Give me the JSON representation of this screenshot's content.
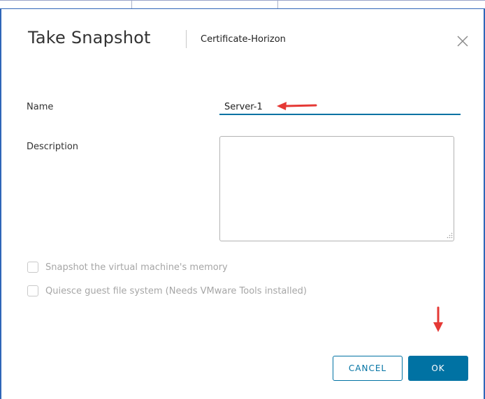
{
  "dialog": {
    "title": "Take Snapshot",
    "subtitle": "Certificate-Horizon",
    "close_icon": "close-icon"
  },
  "form": {
    "name_label": "Name",
    "name_value": "Server-1",
    "description_label": "Description",
    "description_value": "",
    "options": [
      {
        "label": "Snapshot the virtual machine's memory",
        "checked": false,
        "enabled": false
      },
      {
        "label": "Quiesce guest file system (Needs VMware Tools installed)",
        "checked": false,
        "enabled": false
      }
    ]
  },
  "buttons": {
    "cancel_label": "CANCEL",
    "ok_label": "OK"
  },
  "colors": {
    "accent": "#0072a3",
    "annotation_arrow": "#e53935",
    "window_border": "#2f66b8",
    "disabled_text": "#a6a6a6"
  },
  "annotations": [
    {
      "icon": "red-arrow-left-icon",
      "target": "name-input"
    },
    {
      "icon": "red-arrow-down-icon",
      "target": "ok-button"
    }
  ]
}
